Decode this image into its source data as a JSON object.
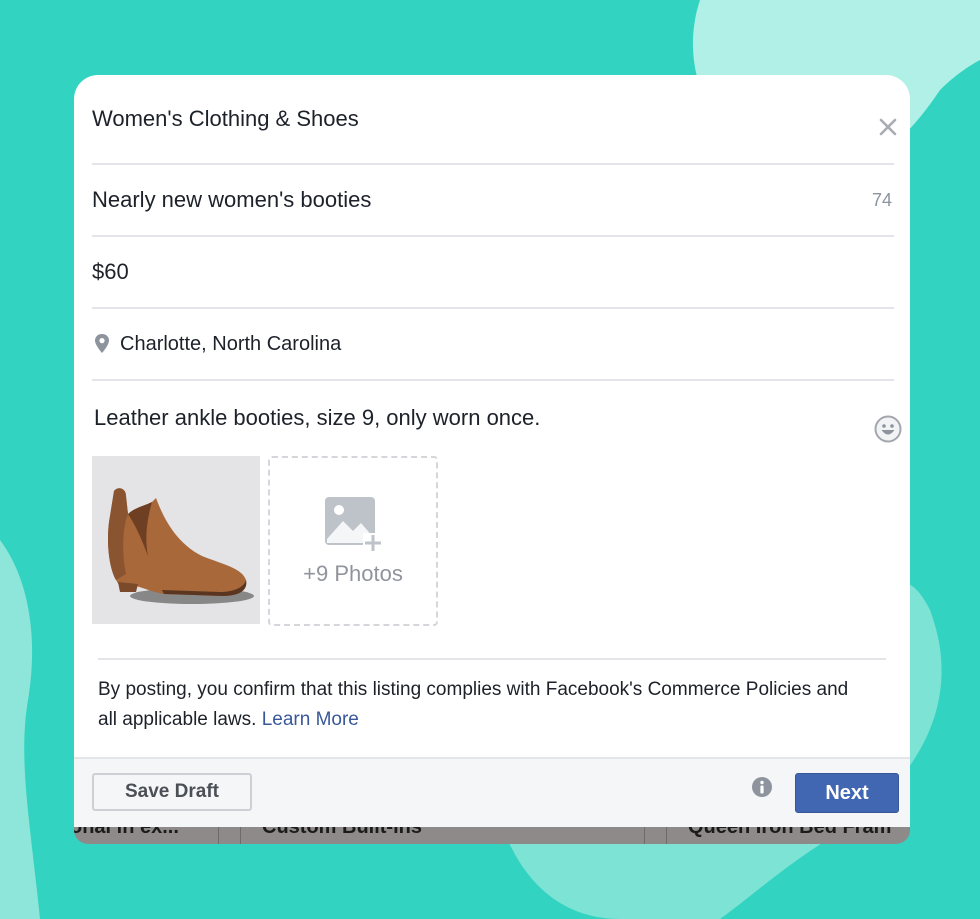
{
  "colors": {
    "background": "#33d3c1",
    "blob_light": "#b0f0e6",
    "blob_mid": "#7de3d5",
    "primary_button": "#4267b2",
    "link": "#385898"
  },
  "listing": {
    "category": "Women's Clothing & Shoes",
    "title": "Nearly new women's booties",
    "title_chars_remaining": "74",
    "price": "$60",
    "location": "Charlotte, North Carolina",
    "description": "Leather ankle booties, size 9, only worn once.",
    "photos": {
      "add_label": "+9 Photos"
    }
  },
  "policy": {
    "text": "By posting, you confirm that this listing complies with Facebook's Commerce Policies and all applicable laws. ",
    "link_label": "Learn More"
  },
  "footer": {
    "save_draft_label": "Save Draft",
    "next_label": "Next"
  },
  "background_listings": [
    "onal in ex...",
    "Custom Built-ins",
    "Queen Iron Bed Fram"
  ],
  "icons": {
    "close": "close-icon",
    "location": "map-pin-icon",
    "emoji": "emoji-icon",
    "add_photo": "add-photo-icon",
    "info": "info-icon"
  }
}
